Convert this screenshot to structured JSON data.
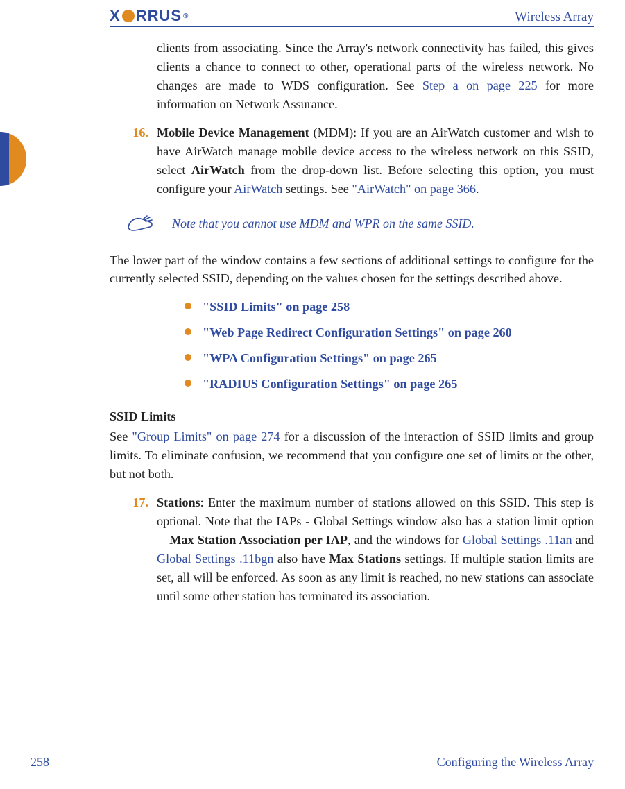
{
  "header": {
    "logo_left": "X",
    "logo_right": "RRUS",
    "logo_reg": "®",
    "title": "Wireless Array"
  },
  "intro_tail": {
    "t1": "clients from associating. Since the Array's network connectivity has failed, this gives clients a chance to connect to other, operational parts of the wireless network. No changes are made to WDS configuration. See ",
    "link": "Step a on page 225",
    "t2": " for more information on Network Assurance."
  },
  "item16": {
    "num": "16.",
    "b1": "Mobile Device Management",
    "t1": " (MDM): If you are an AirWatch customer and wish to have AirWatch manage mobile device access to the wireless network on this SSID, select ",
    "b2": "AirWatch",
    "t2": " from the drop-down list. Before selecting this option, you must configure your ",
    "link1": "AirWatch",
    "t3": " settings. See ",
    "link2": "\"AirWatch\" on page 366",
    "t4": "."
  },
  "note": {
    "text": "Note that you cannot use MDM and WPR on the same SSID."
  },
  "mid_para": "The lower part of the window contains a few sections of additional settings to configure for the currently selected SSID, depending on the values chosen for the settings described above.",
  "bullets": {
    "b1": "\"SSID Limits\" on page 258",
    "b2": "\"Web Page Redirect Configuration Settings\" on page 260",
    "b3": "\"WPA Configuration Settings\" on page 265",
    "b4": "\"RADIUS Configuration Settings\" on page 265"
  },
  "ssid_limits": {
    "head": "SSID Limits",
    "t1": "See ",
    "link": "\"Group Limits\" on page 274",
    "t2": " for a discussion of the interaction of SSID limits and group limits. To eliminate confusion, we recommend that you configure one set of limits or the other, but not both."
  },
  "item17": {
    "num": "17.",
    "b1": "Stations",
    "t1": ": Enter the maximum number of stations allowed on this SSID. This step is optional. Note that the IAPs - Global Settings window also has a station limit option—",
    "b2": "Max Station Association per IAP",
    "t2": ", and the windows for ",
    "link1": "Global Settings .11an",
    "t3": " and ",
    "link2": "Global Settings .11bgn",
    "t4": " also have ",
    "b3": "Max Stations",
    "t5": " settings. If multiple station limits are set, all will be enforced. As soon as any limit is reached, no new stations can associate until some other station has terminated its association."
  },
  "footer": {
    "page": "258",
    "section": "Configuring the Wireless Array"
  }
}
